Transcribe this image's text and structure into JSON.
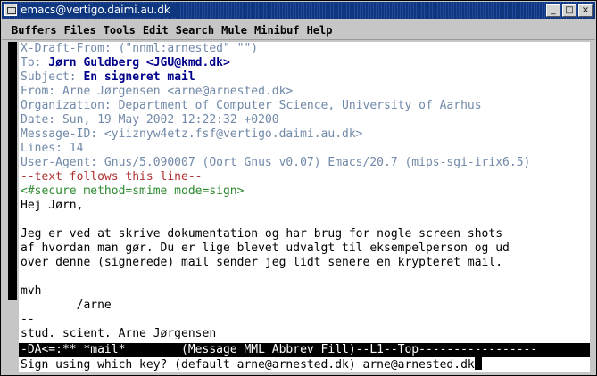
{
  "window": {
    "title": "emacs@vertigo.daimi.au.dk"
  },
  "title_buttons": [
    "_",
    "□",
    "×"
  ],
  "menu": [
    "Buffers",
    "Files",
    "Tools",
    "Edit",
    "Search",
    "Mule",
    "Minibuf",
    "Help"
  ],
  "message": {
    "xdraft": {
      "name": "X-Draft-From:",
      "value": " (\"nnml:arnested\" \"\")"
    },
    "to": {
      "name": "To:",
      "value": " Jørn Guldberg <JGU@kmd.dk>"
    },
    "subject": {
      "name": "Subject:",
      "value": " En signeret mail"
    },
    "from": {
      "name": "From:",
      "value": " Arne Jørgensen <arne@arnested.dk>"
    },
    "organization": {
      "name": "Organization:",
      "value": " Department of Computer Science, University of Aarhus"
    },
    "date": {
      "name": "Date:",
      "value": " Sun, 19 May 2002 12:22:32 +0200"
    },
    "message_id": {
      "name": "Message-ID:",
      "value": " <yiiznyw4etz.fsf@vertigo.daimi.au.dk>"
    },
    "lines": {
      "name": "Lines:",
      "value": " 14"
    },
    "user_agent": {
      "name": "User-Agent:",
      "value": " Gnus/5.090007 (Oort Gnus v0.07) Emacs/20.7 (mips-sgi-irix6.5)"
    },
    "separator": "--text follows this line--",
    "secure_tag": "<#secure method=smime mode=sign>",
    "body": [
      "Hej Jørn,",
      "",
      "Jeg er ved at skrive dokumentation og har brug for nogle screen shots",
      "af hvordan man gør. Du er lige blevet udvalgt til eksempelperson og ud",
      "over denne (signerede) mail sender jeg lidt senere en krypteret mail.",
      "",
      "mvh",
      "        /arne",
      "--",
      "stud. scient. Arne Jørgensen"
    ]
  },
  "modeline": "-DA<=:** *mail*        (Message MML Abbrev Fill)--L1--Top-----------------",
  "minibuffer": {
    "prompt": "Sign using which key? (default arne@arnested.dk) ",
    "input": "arne@arnested.dk"
  }
}
